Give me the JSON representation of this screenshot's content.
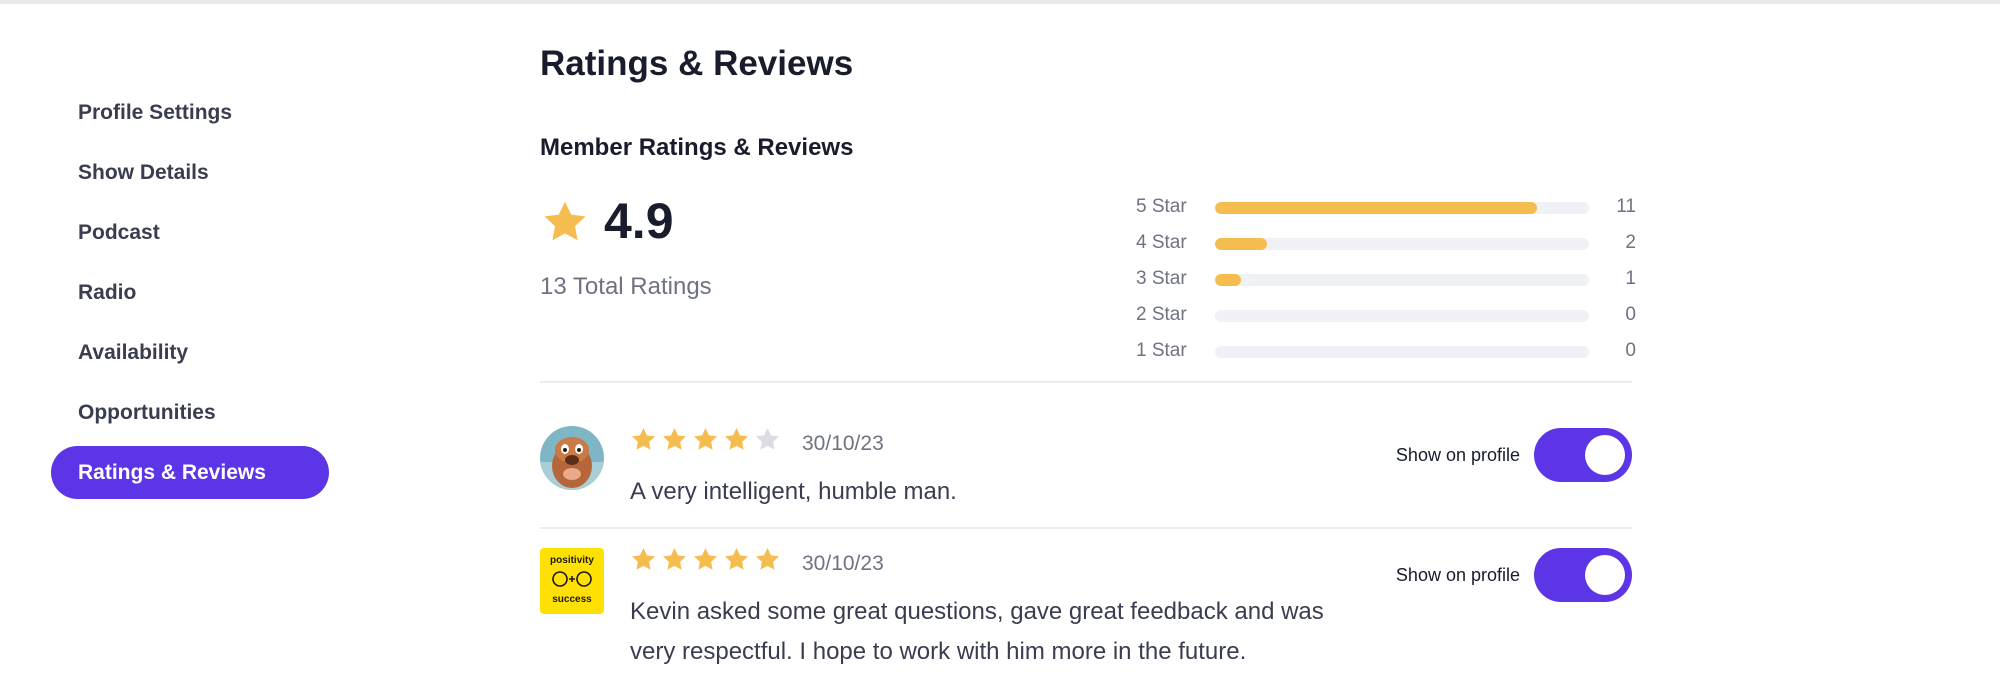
{
  "colors": {
    "accent": "#5b35e6",
    "star": "#f5bd50",
    "star_empty": "#dcdde3"
  },
  "sidebar": {
    "items": [
      {
        "label": "Profile Settings",
        "active": false
      },
      {
        "label": "Show Details",
        "active": false
      },
      {
        "label": "Podcast",
        "active": false
      },
      {
        "label": "Radio",
        "active": false
      },
      {
        "label": "Availability",
        "active": false
      },
      {
        "label": "Opportunities",
        "active": false
      },
      {
        "label": "Ratings & Reviews",
        "active": true
      }
    ]
  },
  "page": {
    "title": "Ratings & Reviews",
    "section_title": "Member Ratings & Reviews"
  },
  "summary": {
    "average": "4.9",
    "total_label": "13 Total Ratings",
    "icon": "star-icon",
    "breakdown": [
      {
        "label": "5 Star",
        "count": "11",
        "fraction": 0.86
      },
      {
        "label": "4 Star",
        "count": "2",
        "fraction": 0.14
      },
      {
        "label": "3 Star",
        "count": "1",
        "fraction": 0.07
      },
      {
        "label": "2 Star",
        "count": "0",
        "fraction": 0
      },
      {
        "label": "1 Star",
        "count": "0",
        "fraction": 0
      }
    ]
  },
  "reviews": [
    {
      "rating": 4,
      "date": "30/10/23",
      "text": "A very intelligent, humble man.",
      "show_label": "Show on profile",
      "show_on_profile": true,
      "avatar": "avatar-photo"
    },
    {
      "rating": 5,
      "date": "30/10/23",
      "text": "Kevin asked some great questions, gave great feedback and was very respectful. I hope to work with him more in the future.",
      "show_label": "Show on profile",
      "show_on_profile": true,
      "avatar": "positivity-success-logo",
      "avatar_text_top": "positivity",
      "avatar_text_bottom": "success"
    }
  ]
}
